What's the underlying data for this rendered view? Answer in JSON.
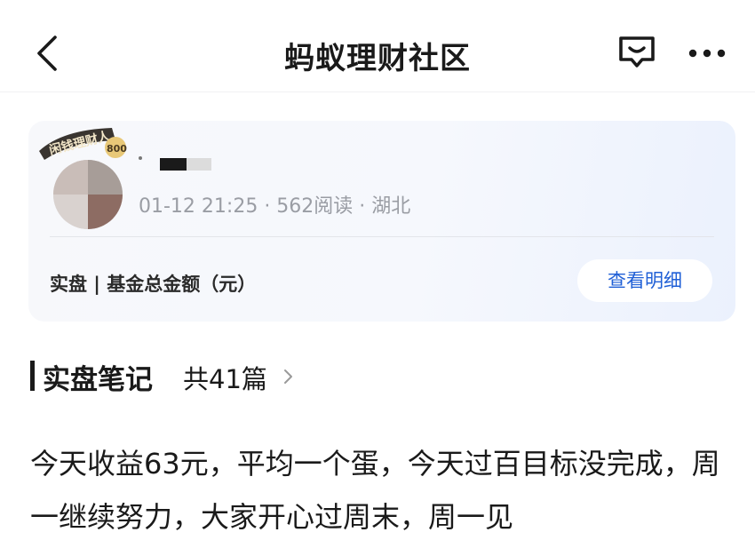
{
  "nav": {
    "title": "蚂蚁理财社区",
    "back_icon": "chevron-left-icon",
    "chat_icon": "chat-icon",
    "more_icon": "more-dots-icon"
  },
  "card": {
    "badge_text": "闲钱理财人",
    "badge_level": "800",
    "meta": "01-12 21:25 · 562阅读 · 湖北",
    "label": "实盘 | 基金总金额（元）",
    "detail_button": "查看明细"
  },
  "section": {
    "title": "实盘笔记",
    "count": "共41篇"
  },
  "post": {
    "text": "今天收益63元，平均一个蛋，今天过百目标没完成，周一继续努力，大家开心过周末，周一见"
  },
  "colors": {
    "accent": "#1f5fd6",
    "meta_gray": "#9a9da4"
  }
}
